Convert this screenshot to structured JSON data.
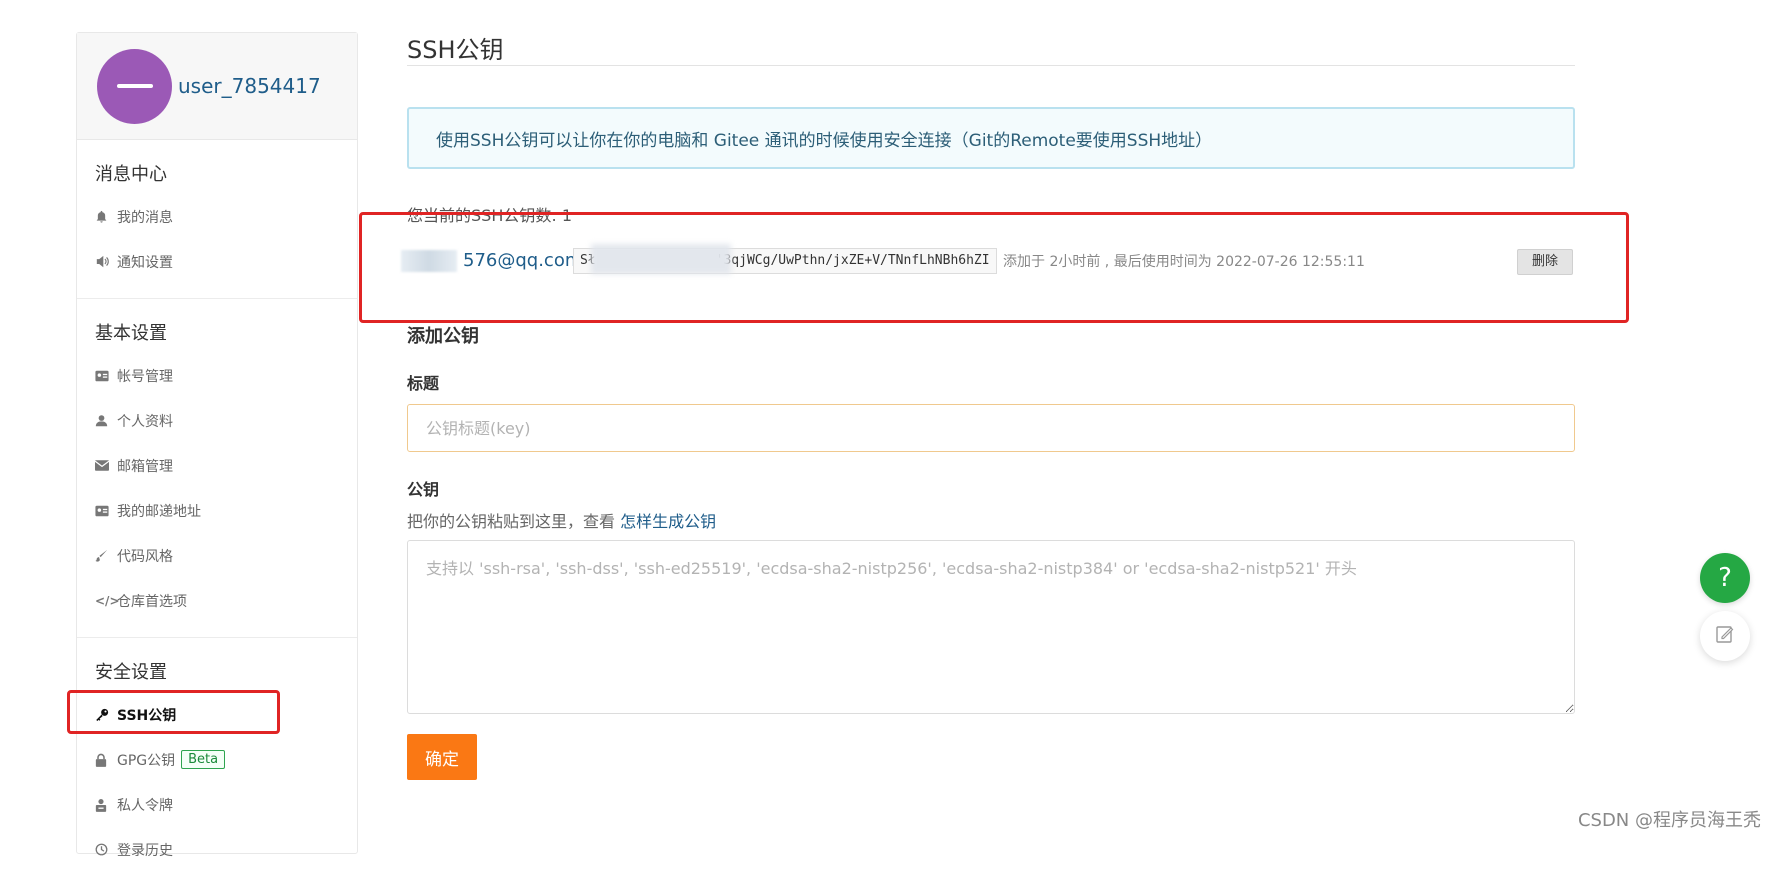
{
  "user": {
    "name": "user_7854417"
  },
  "sidebar": {
    "sections": [
      {
        "title": "消息中心",
        "items": [
          {
            "label": "我的消息",
            "icon": "bell-icon"
          },
          {
            "label": "通知设置",
            "icon": "speaker-icon"
          }
        ]
      },
      {
        "title": "基本设置",
        "items": [
          {
            "label": "帐号管理",
            "icon": "id-card-icon"
          },
          {
            "label": "个人资料",
            "icon": "user-icon"
          },
          {
            "label": "邮箱管理",
            "icon": "envelope-icon"
          },
          {
            "label": "我的邮递地址",
            "icon": "address-card-icon"
          },
          {
            "label": "代码风格",
            "icon": "brush-icon"
          },
          {
            "label": "仓库首选项",
            "icon": "code-icon"
          }
        ]
      },
      {
        "title": "安全设置",
        "items": [
          {
            "label": "SSH公钥",
            "icon": "key-icon",
            "active": true
          },
          {
            "label": "GPG公钥",
            "icon": "lock-icon",
            "badge": "Beta"
          },
          {
            "label": "私人令牌",
            "icon": "token-icon"
          },
          {
            "label": "登录历史",
            "icon": "history-icon"
          }
        ]
      }
    ]
  },
  "main": {
    "title": "SSH公钥",
    "info": "使用SSH公钥可以让你在你的电脑和 Gitee 通讯的时候使用安全连接（Git的Remote要使用SSH地址）",
    "count_text": "您当前的SSH公钥数: 1",
    "key": {
      "email_suffix": "576@qq.com",
      "fingerprint_prefix": "Sł",
      "fingerprint": "'3qjWCg/UwPthn/jxZE+V/TNnfLhNBh6hZI",
      "meta": "添加于 2小时前 , 最后使用时间为 2022-07-26 12:55:11",
      "delete_label": "删除"
    },
    "add_title": "添加公钥",
    "title_label": "标题",
    "title_placeholder": "公钥标题(key)",
    "key_label": "公钥",
    "key_help": "把你的公钥粘贴到这里，查看 ",
    "key_help_link": "怎样生成公钥",
    "key_placeholder": "支持以 'ssh-rsa', 'ssh-dss', 'ssh-ed25519', 'ecdsa-sha2-nistp256', 'ecdsa-sha2-nistp384' or 'ecdsa-sha2-nistp521' 开头",
    "confirm_label": "确定"
  },
  "floating": {
    "help_label": "?"
  },
  "watermark": "CSDN @程序员海王秃",
  "colors": {
    "accent": "#fa7814",
    "link": "#1f5d8a",
    "avatar": "#9b59b6",
    "help": "#25a844",
    "annotation": "#e02424"
  }
}
